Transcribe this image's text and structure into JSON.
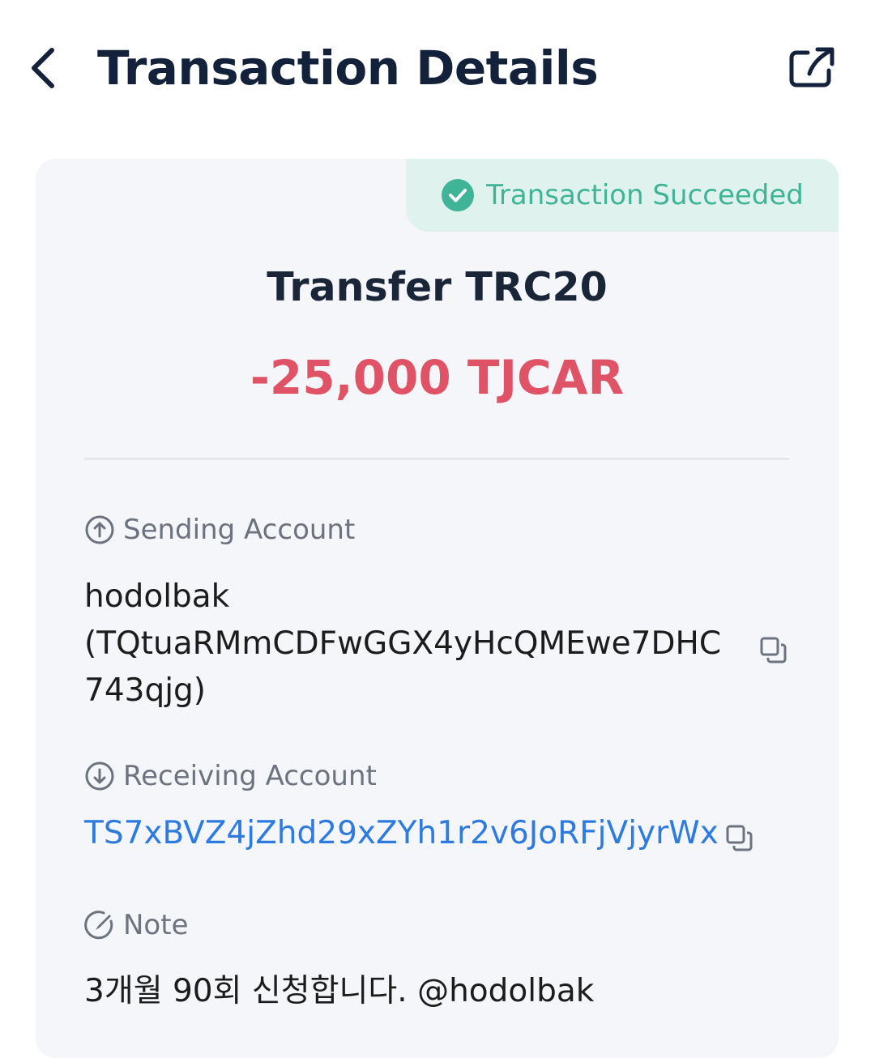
{
  "header": {
    "title": "Transaction Details",
    "back_icon": "chevron-left-icon",
    "share_icon": "external-share-icon"
  },
  "status": {
    "label": "Transaction Succeeded",
    "icon": "check-circle-icon",
    "color": "#3fb496"
  },
  "transaction": {
    "type": "Transfer TRC20",
    "amount": "-25,000 TJCAR",
    "amount_color": "#e05367"
  },
  "sending": {
    "label": "Sending Account",
    "icon": "arrow-up-circle-icon",
    "value_line1": "hodolbak",
    "value_line2": "(TQtuaRMmCDFwGGX4yHcQMEwe7DHC",
    "value_line3": "743qjg)"
  },
  "receiving": {
    "label": "Receiving Account",
    "icon": "arrow-down-circle-icon",
    "value": "TS7xBVZ4jZhd29xZYh1r2v6JoRFjVjyrWx",
    "link_color": "#2e7be0"
  },
  "note": {
    "label": "Note",
    "icon": "edit-circle-icon",
    "value": "3개월 90회 신청합니다. @hodolbak"
  }
}
